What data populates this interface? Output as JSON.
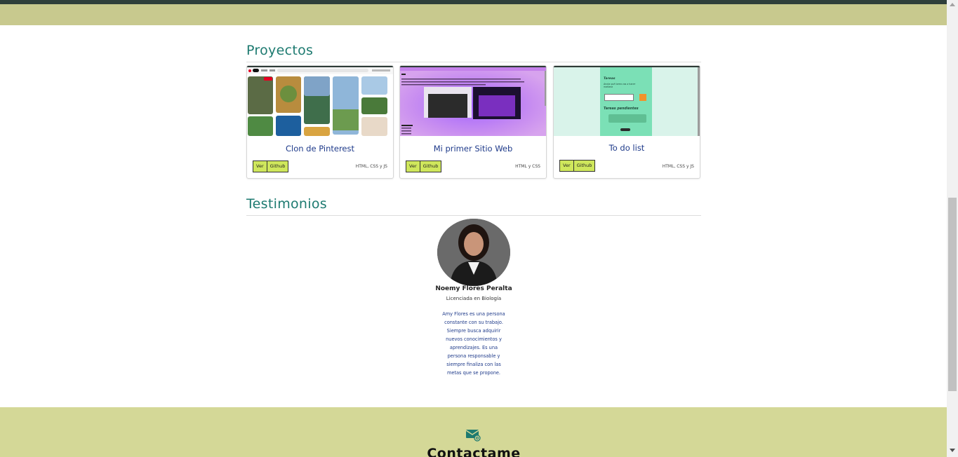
{
  "sections": {
    "projects_title": "Proyectos",
    "testimonials_title": "Testimonios"
  },
  "projects": [
    {
      "title": "Clon de Pinterest",
      "view_label": "Ver",
      "github_label": "Github",
      "tech": "HTML, CSS y JS"
    },
    {
      "title": "Mi primer Sitio Web",
      "view_label": "Ver",
      "github_label": "Github",
      "tech": "HTML y CSS"
    },
    {
      "title": "To do list",
      "view_label": "Ver",
      "github_label": "Github",
      "tech": "HTML, CSS y JS"
    }
  ],
  "todo_preview": {
    "heading": "Tareas",
    "subheading": "Anota qué tarea vas a hacer mañana",
    "pending": "Tareas pendientes"
  },
  "testimonial": {
    "name": "Noemy Flores Peralta",
    "role": "Licenciada en Biología",
    "quote": "Amy Flores es una persona constante con su trabajo. Siempre busca adquirir nuevos conocimientos y aprendizajes. Es una persona responsable y siempre finaliza con las metas que se propone."
  },
  "footer": {
    "icon": "mail-icon",
    "title": "Contactame"
  },
  "colors": {
    "accent": "#1d7a70",
    "band": "#c8c98e",
    "footer": "#d4d897",
    "button": "#cfe75c",
    "link_text": "#1e3a8a"
  }
}
